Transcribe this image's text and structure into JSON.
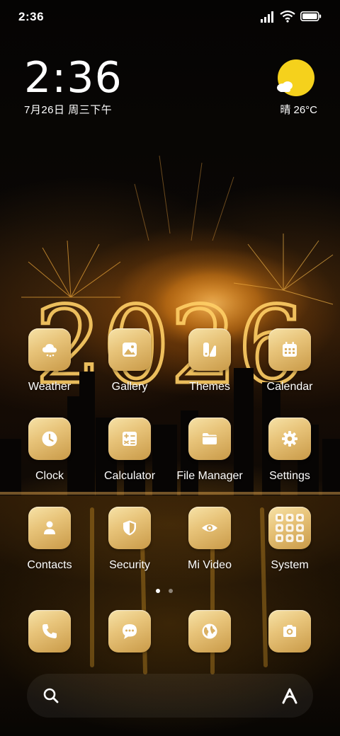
{
  "status_bar": {
    "time": "2:36",
    "icons": [
      "signal-icon",
      "wifi-icon",
      "battery-icon"
    ]
  },
  "clock_widget": {
    "time": "2:36",
    "date": "7月26日 周三下午"
  },
  "weather_widget": {
    "icon": "partly-sunny-icon",
    "text": "晴 26°C"
  },
  "wallpaper": {
    "year_text": "2026"
  },
  "apps": [
    {
      "label": "Weather",
      "icon": "weather-cloud-icon"
    },
    {
      "label": "Gallery",
      "icon": "gallery-icon"
    },
    {
      "label": "Themes",
      "icon": "themes-icon"
    },
    {
      "label": "Calendar",
      "icon": "calendar-icon"
    },
    {
      "label": "Clock",
      "icon": "clock-icon"
    },
    {
      "label": "Calculator",
      "icon": "calculator-icon"
    },
    {
      "label": "File Manager",
      "icon": "folder-icon"
    },
    {
      "label": "Settings",
      "icon": "gear-icon"
    },
    {
      "label": "Contacts",
      "icon": "contacts-icon"
    },
    {
      "label": "Security",
      "icon": "shield-icon"
    },
    {
      "label": "Mi Video",
      "icon": "eye-icon"
    },
    {
      "label": "System",
      "icon": "folder-grid-icon"
    }
  ],
  "page_indicator": {
    "pages": 2,
    "current": 1
  },
  "dock": [
    {
      "icon": "phone-icon"
    },
    {
      "icon": "message-icon"
    },
    {
      "icon": "browser-globe-icon"
    },
    {
      "icon": "camera-icon"
    }
  ],
  "search_bar": {
    "left_icon": "search-icon",
    "right_icon": "assistant-icon"
  },
  "colors": {
    "icon_gold_light": "#f7e3a8",
    "icon_gold_dark": "#c99a48",
    "glyph_color": "#ffffff",
    "sun_yellow": "#f5d11c"
  }
}
